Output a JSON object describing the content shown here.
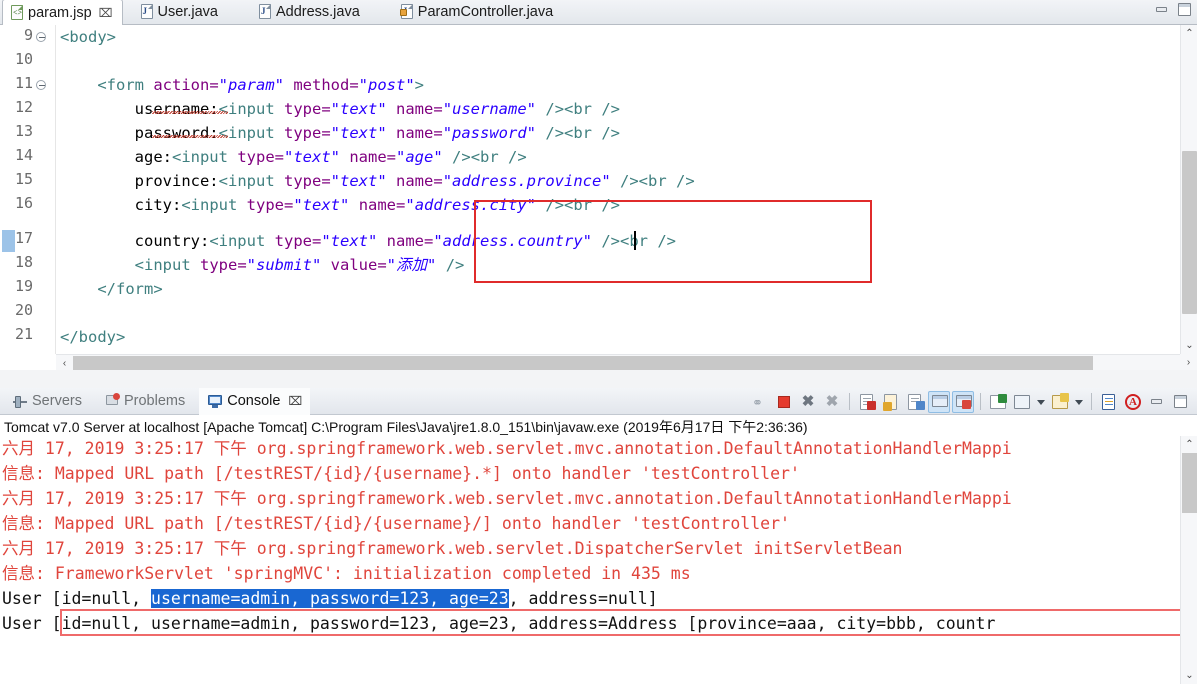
{
  "window": {
    "minimize_label": "–",
    "maximize_label": "□"
  },
  "editor_tabs": [
    {
      "label": "param.jsp",
      "icon": "jsp-file-icon",
      "active": true,
      "close": "⌧"
    },
    {
      "label": "User.java",
      "icon": "java-file-icon",
      "active": false
    },
    {
      "label": "Address.java",
      "icon": "java-file-icon",
      "active": false
    },
    {
      "label": "ParamController.java",
      "icon": "java-file-locked-icon",
      "active": false
    }
  ],
  "editor": {
    "lines": [
      {
        "num": "9",
        "fold": true,
        "indent": 0,
        "text": "<body>"
      },
      {
        "num": "10",
        "fold": false,
        "indent": 0,
        "text": ""
      },
      {
        "num": "11",
        "fold": true,
        "indent": 0,
        "text": "<form action=\"param\" method=\"post\">"
      },
      {
        "num": "12",
        "fold": false,
        "indent": 0,
        "text": "username:<input type=\"text\" name=\"username\" /><br />"
      },
      {
        "num": "13",
        "fold": false,
        "indent": 0,
        "text": "password:<input type=\"text\" name=\"password\" /><br />"
      },
      {
        "num": "14",
        "fold": false,
        "indent": 0,
        "text": "age:<input type=\"text\" name=\"age\" /><br />"
      },
      {
        "num": "15",
        "fold": false,
        "indent": 0,
        "text": "province:<input type=\"text\" name=\"address.province\" /><br />"
      },
      {
        "num": "16",
        "fold": false,
        "indent": 0,
        "text": "city:<input type=\"text\" name=\"address.city\" /><br />"
      },
      {
        "num": "17",
        "fold": false,
        "indent": 0,
        "text": "country:<input type=\"text\" name=\"address.country\" /><br />"
      },
      {
        "num": "18",
        "fold": false,
        "indent": 0,
        "text": "<input type=\"submit\" value=\"添加\" />"
      },
      {
        "num": "19",
        "fold": false,
        "indent": 0,
        "text": "</form>"
      },
      {
        "num": "20",
        "fold": false,
        "indent": 0,
        "text": ""
      },
      {
        "num": "21",
        "fold": false,
        "indent": 0,
        "text": "</body>"
      }
    ],
    "current_line": "17",
    "annotation_color": "#e02b2b",
    "scroll_up": "⌃",
    "scroll_down": "⌄",
    "scroll_left": "‹",
    "scroll_right": "›"
  },
  "console_tabs": [
    {
      "label": "Servers",
      "icon": "servers-icon",
      "active": false
    },
    {
      "label": "Problems",
      "icon": "problems-icon",
      "active": false
    },
    {
      "label": "Console",
      "icon": "console-icon",
      "active": true,
      "close": "⌧"
    }
  ],
  "console_toolbar": [
    {
      "name": "link-with-editor-icon"
    },
    {
      "name": "terminate-icon"
    },
    {
      "name": "remove-launch-icon"
    },
    {
      "name": "remove-all-terminated-icon"
    },
    {
      "name": "separator-1"
    },
    {
      "name": "clear-console-icon"
    },
    {
      "name": "lock-scroll-icon"
    },
    {
      "name": "word-wrap-icon"
    },
    {
      "name": "show-console-on-output-icon",
      "selected": true
    },
    {
      "name": "show-console-on-error-icon",
      "selected": true
    },
    {
      "name": "separator-2"
    },
    {
      "name": "pin-console-icon"
    },
    {
      "name": "display-selected-console-icon"
    },
    {
      "name": "display-selected-console-dropdown"
    },
    {
      "name": "open-console-icon"
    },
    {
      "name": "open-console-dropdown"
    },
    {
      "name": "separator-3"
    },
    {
      "name": "new-console-view-icon"
    },
    {
      "name": "ant-icon"
    },
    {
      "name": "minimize-view-icon"
    },
    {
      "name": "maximize-view-icon"
    }
  ],
  "console": {
    "process_line": "Tomcat v7.0 Server at localhost [Apache Tomcat] C:\\Program Files\\Java\\jre1.8.0_151\\bin\\javaw.exe (2019年6月17日 下午2:36:36)",
    "log_lines": [
      {
        "kind": "err",
        "text": "六月 17, 2019 3:25:17 下午 org.springframework.web.servlet.mvc.annotation.DefaultAnnotationHandlerMappi"
      },
      {
        "kind": "err",
        "text": "信息: Mapped URL path [/testREST/{id}/{username}.*] onto handler 'testController'"
      },
      {
        "kind": "err",
        "text": "六月 17, 2019 3:25:17 下午 org.springframework.web.servlet.mvc.annotation.DefaultAnnotationHandlerMappi"
      },
      {
        "kind": "err",
        "text": "信息: Mapped URL path [/testREST/{id}/{username}/] onto handler 'testController'"
      },
      {
        "kind": "err",
        "text": "六月 17, 2019 3:25:17 下午 org.springframework.web.servlet.DispatcherServlet initServletBean"
      },
      {
        "kind": "err",
        "text": "信息: FrameworkServlet 'springMVC': initialization completed in 435 ms"
      },
      {
        "kind": "out_sel",
        "pre": "User [id=null, ",
        "sel": "username=admin, password=123, age=23",
        "post": ", address=null]"
      },
      {
        "kind": "out_box",
        "text": "User [id=null, username=admin, password=123, age=23, address=Address [province=aaa, city=bbb, countr"
      }
    ],
    "scroll_up": "⌃",
    "scroll_down": "⌄"
  },
  "colors": {
    "error_text": "#e0453c",
    "stdout_text": "#111111",
    "selection_bg": "#1967d2",
    "annotation_red": "#e02b2b",
    "annotation_soft_red": "#ef6a6a",
    "tag_color": "#3f7f7f",
    "attr_color": "#7f007f",
    "value_color": "#2a00ff",
    "current_line_bg": "#eaf2fb"
  }
}
